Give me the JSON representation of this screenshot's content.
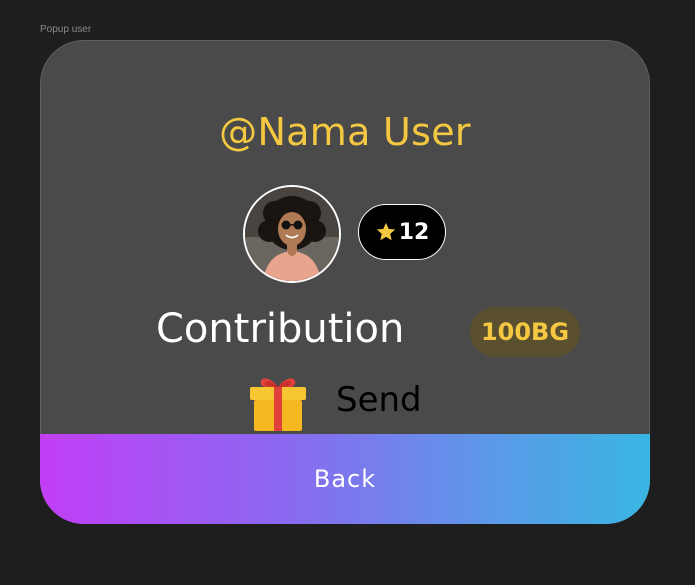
{
  "frame": {
    "label": "Popup user"
  },
  "popup": {
    "username": "@Nama User",
    "avatar": {
      "icon": "avatar-photo"
    },
    "stars": {
      "icon": "star-icon",
      "count": "12",
      "star_color": "#f5c842"
    },
    "contribution": {
      "label": "Contribution",
      "amount": "100BG"
    },
    "send": {
      "icon": "gift-icon",
      "label": "Send"
    },
    "back": {
      "label": "Back"
    }
  },
  "colors": {
    "background": "#1e1e1e",
    "popup": "#4a4a4a",
    "accent_yellow": "#f5c842",
    "gradient_start": "#c13ef7",
    "gradient_end": "#39b6e3"
  }
}
